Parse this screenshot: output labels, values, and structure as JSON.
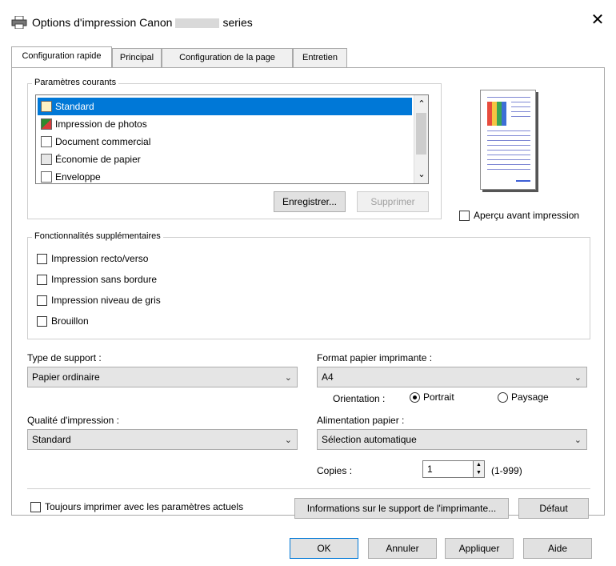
{
  "window": {
    "title_prefix": "Options d'impression Canon",
    "title_suffix": "series"
  },
  "tabs": [
    {
      "label": "Configuration rapide",
      "active": true
    },
    {
      "label": "Principal",
      "active": false
    },
    {
      "label": "Configuration de la page",
      "active": false
    },
    {
      "label": "Entretien",
      "active": false
    }
  ],
  "current_settings": {
    "title": "Paramètres courants",
    "items": [
      {
        "label": "Standard",
        "icon": "standard-icon",
        "selected": true
      },
      {
        "label": "Impression de photos",
        "icon": "photo-icon",
        "selected": false
      },
      {
        "label": "Document commercial",
        "icon": "document-icon",
        "selected": false
      },
      {
        "label": "Économie de papier",
        "icon": "paper-saving-icon",
        "selected": false
      },
      {
        "label": "Enveloppe",
        "icon": "envelope-icon",
        "selected": false
      }
    ],
    "save_label": "Enregistrer...",
    "delete_label": "Supprimer"
  },
  "preview": {
    "checkbox_label": "Aperçu avant impression"
  },
  "additional_features": {
    "title": "Fonctionnalités supplémentaires",
    "items": [
      {
        "label": "Impression recto/verso",
        "checked": false
      },
      {
        "label": "Impression sans bordure",
        "checked": false
      },
      {
        "label": "Impression niveau de gris",
        "checked": false
      },
      {
        "label": "Brouillon",
        "checked": false
      }
    ]
  },
  "media_type": {
    "label": "Type de support :",
    "value": "Papier ordinaire"
  },
  "printer_paper_size": {
    "label": "Format papier imprimante :",
    "value": "A4"
  },
  "orientation": {
    "label": "Orientation :",
    "portrait": "Portrait",
    "landscape": "Paysage",
    "selected": "portrait"
  },
  "print_quality": {
    "label": "Qualité d'impression :",
    "value": "Standard"
  },
  "paper_source": {
    "label": "Alimentation papier :",
    "value": "Sélection automatique"
  },
  "copies": {
    "label": "Copies :",
    "value": "1",
    "range": "(1-999)"
  },
  "always_print": {
    "label": "Toujours imprimer avec les paramètres actuels"
  },
  "media_info_button": "Informations sur le support de l'imprimante...",
  "default_button": "Défaut",
  "footer": {
    "ok": "OK",
    "cancel": "Annuler",
    "apply": "Appliquer",
    "help": "Aide"
  },
  "colors": {
    "selection": "#0078d7",
    "button_face": "#e1e1e1"
  }
}
